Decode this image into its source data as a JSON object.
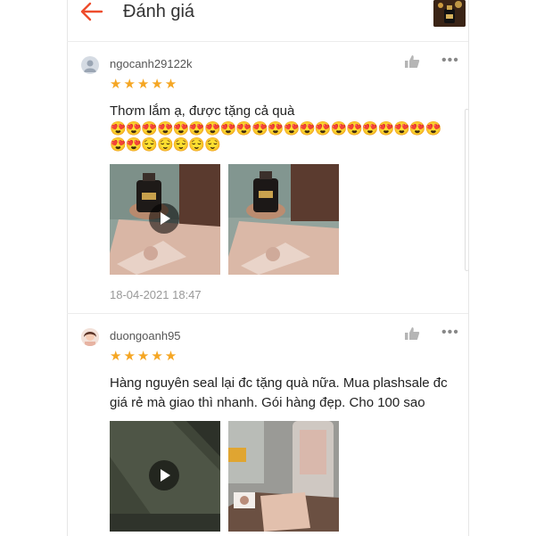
{
  "header": {
    "title": "Đánh giá",
    "back_icon": "back-arrow-icon",
    "accent_color": "#ee4d2d"
  },
  "reviews": [
    {
      "username": "ngocanh29122k",
      "rating": 5,
      "stars": "★★★★★",
      "text": "Thơm lắm ạ, được tặng cả quà",
      "emoji_line1": "😍😍😍😍😍😍😍😍😍😍😍😍😍😍😍😍😍😍😍😍😍",
      "emoji_line2": "😍😍😌😌😌😌😌",
      "media": [
        "video",
        "photo"
      ],
      "date": "18-04-2021 18:47"
    },
    {
      "username": "duongoanh95",
      "rating": 5,
      "stars": "★★★★★",
      "text": "Hàng nguyên seal lại đc tặng quà nữa. Mua plashsale đc giá rẻ mà giao thì nhanh. Gói hàng đẹp. Cho 100 sao",
      "media": [
        "video",
        "photo"
      ]
    }
  ]
}
